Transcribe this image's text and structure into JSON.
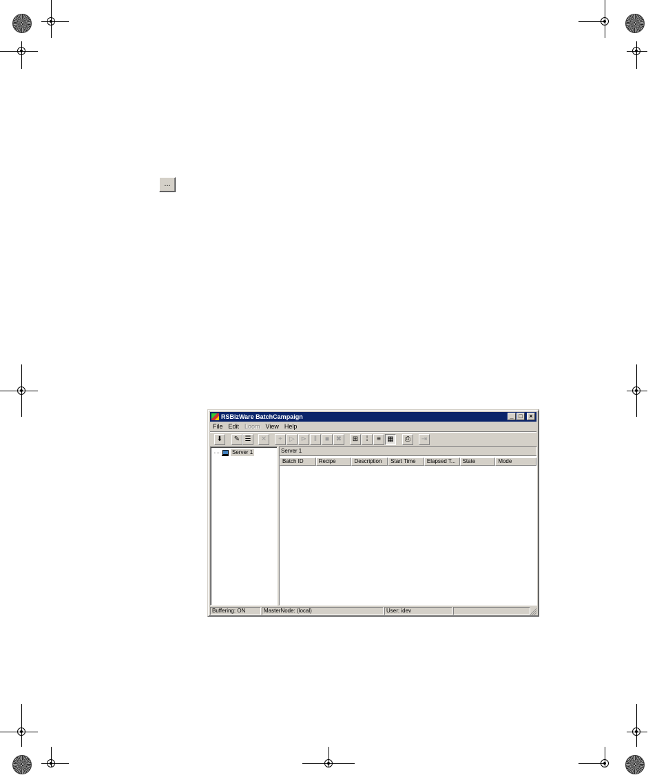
{
  "ellipsis_button": {
    "label": "..."
  },
  "window": {
    "title": "RSBizWare BatchCampaign",
    "controls": {
      "minimize": "_",
      "maximize": "□",
      "close": "×"
    },
    "menu": [
      {
        "label": "File",
        "enabled": true
      },
      {
        "label": "Edit",
        "enabled": true
      },
      {
        "label": "Loom",
        "enabled": false
      },
      {
        "label": "View",
        "enabled": true
      },
      {
        "label": "Help",
        "enabled": true
      }
    ],
    "toolbar": [
      {
        "icon": "green-down-arrow-icon",
        "glyph": "⬇",
        "enabled": true
      },
      {
        "icon": "edit-pencil-icon",
        "glyph": "✎",
        "enabled": true
      },
      {
        "icon": "list-icon",
        "glyph": "☰",
        "enabled": true
      },
      {
        "icon": "delete-x-icon",
        "glyph": "✕",
        "enabled": false
      },
      {
        "icon": "add-plus-icon",
        "glyph": "+",
        "enabled": false
      },
      {
        "icon": "start-icon",
        "glyph": "▷",
        "enabled": false
      },
      {
        "icon": "step-icon",
        "glyph": "⊳",
        "enabled": false
      },
      {
        "icon": "hold-icon",
        "glyph": "‖",
        "enabled": false
      },
      {
        "icon": "stop-icon",
        "glyph": "■",
        "enabled": false
      },
      {
        "icon": "abort-icon",
        "glyph": "✖",
        "enabled": false
      },
      {
        "icon": "large-icons-view-icon",
        "glyph": "⊞",
        "enabled": true
      },
      {
        "icon": "small-icons-view-icon",
        "glyph": "⁞",
        "enabled": true
      },
      {
        "icon": "list-view-icon",
        "glyph": "≡",
        "enabled": true
      },
      {
        "icon": "details-view-icon",
        "glyph": "▦",
        "enabled": true,
        "pressed": true
      },
      {
        "icon": "properties-icon",
        "glyph": "⎙",
        "enabled": true
      },
      {
        "icon": "exit-icon",
        "glyph": "⇥",
        "enabled": false
      }
    ],
    "tree": {
      "root_label": "Server 1"
    },
    "pane_caption": "Server 1",
    "columns": [
      "Batch ID",
      "Recipe",
      "Description",
      "Start Time",
      "Elapsed T...",
      "State",
      "Mode"
    ],
    "status": {
      "buffering": "Buffering: ON",
      "master_node": "MasterNode: (local)",
      "user": "User: idev",
      "extra": ""
    }
  }
}
